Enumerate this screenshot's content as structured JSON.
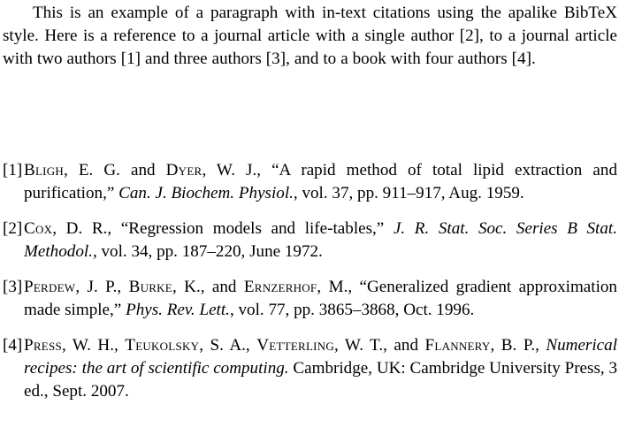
{
  "document": {
    "intro_paragraph": "This is an example of a paragraph with in-text citations using the apalike BibTeX style. Here is a reference to a journal article with a single author [2], to a journal article with two authors [1] and three authors [3], and to a book with four authors [4].",
    "bibliography": [
      {
        "label": "[1]",
        "number": 1,
        "authors_smallcaps": [
          "Bligh",
          "Dyer"
        ],
        "author_string": "Bligh, E. G. and Dyer, W. J.",
        "title": "“A rapid method of total lipid extraction and purification,”",
        "journal_italic": "Can. J. Biochem. Physiol.",
        "volume": "vol. 37",
        "pages": "pp. 911–917",
        "date": "Aug. 1959.",
        "full_text": "Bligh, E. G. and Dyer, W. J., “A rapid method of total lipid extraction and purification,” Can. J. Biochem. Physiol., vol. 37, pp. 911–917, Aug. 1959."
      },
      {
        "label": "[2]",
        "number": 2,
        "authors_smallcaps": [
          "Cox"
        ],
        "author_string": "Cox, D. R.",
        "title": "“Regression models and life-tables,”",
        "journal_italic": "J. R. Stat. Soc. Series B Stat. Methodol.",
        "volume": "vol. 34",
        "pages": "pp. 187–220",
        "date": "June 1972.",
        "full_text": "Cox, D. R., “Regression models and life-tables,” J. R. Stat. Soc. Series B Stat. Methodol., vol. 34, pp. 187–220, June 1972."
      },
      {
        "label": "[3]",
        "number": 3,
        "authors_smallcaps": [
          "Perdew",
          "Burke",
          "Ernzerhof"
        ],
        "author_string": "Perdew, J. P., Burke, K., and Ernzerhof, M.",
        "title": "“Generalized gradient approximation made simple,”",
        "journal_italic": "Phys. Rev. Lett.",
        "volume": "vol. 77",
        "pages": "pp. 3865–3868",
        "date": "Oct. 1996.",
        "full_text": "Perdew, J. P., Burke, K., and Ernzerhof, M., “Generalized gradient approximation made simple,” Phys. Rev. Lett., vol. 77, pp. 3865–3868, Oct. 1996."
      },
      {
        "label": "[4]",
        "number": 4,
        "authors_smallcaps": [
          "Press",
          "Teukolsky",
          "Vetterling",
          "Flannery"
        ],
        "author_string": "Press, W. H., Teukolsky, S. A., Vetterling, W. T., and Flannery, B. P.",
        "title_italic": "Numerical recipes: the art of scientific computing.",
        "publisher": "Cambridge, UK: Cambridge University Press",
        "edition": "3 ed.",
        "date": "Sept. 2007.",
        "full_text": "Press, W. H., Teukolsky, S. A., Vetterling, W. T., and Flannery, B. P., Numerical recipes: the art of scientific computing. Cambridge, UK: Cambridge University Press, 3 ed., Sept. 2007."
      }
    ],
    "entry_1": {
      "au1_sc": "Bligh",
      "au1_init": ", E. G. and ",
      "au2_sc": "Dyer",
      "au2_init": ", W. J., ",
      "title": "“A rapid method of total lipid extraction and purification,” ",
      "journal": "Can. J. Biochem. Physiol.",
      "tail": ", vol. 37, pp. 911–917, Aug. 1959."
    },
    "entry_2": {
      "au1_sc": "Cox",
      "au1_init": ", D. R., ",
      "title": "“Regression models and life-tables,” ",
      "journal": "J. R. Stat. Soc. Series B Stat. Methodol.",
      "tail": ", vol. 34, pp. 187–220, June 1972."
    },
    "entry_3": {
      "au1_sc": "Perdew",
      "au1_init": ", J. P., ",
      "au2_sc": "Burke",
      "au2_init": ", K., and ",
      "au3_sc": "Ernzerhof",
      "au3_init": ", M., ",
      "title": "“Generalized gradient approximation made simple,” ",
      "journal": "Phys. Rev. Lett.",
      "tail": ", vol. 77, pp. 3865–3868, Oct. 1996."
    },
    "entry_4": {
      "au1_sc": "Press",
      "au1_init": ", W. H., ",
      "au2_sc": "Teukolsky",
      "au2_init": ", S. A., ",
      "au3_sc": "Vetterling",
      "au3_init": ", W. T., and ",
      "au4_sc": "Flannery",
      "au4_init": ", B. P., ",
      "title": "Numerical recipes: the art of scientific computing.",
      "tail": " Cambridge, UK: Cambridge University Press, 3 ed., Sept. 2007."
    }
  }
}
